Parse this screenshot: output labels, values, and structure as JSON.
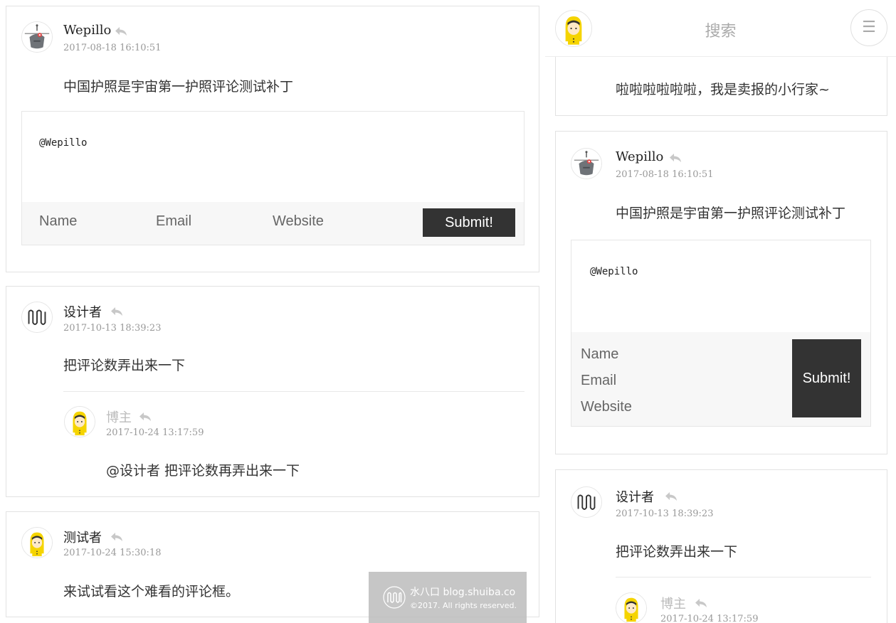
{
  "header": {
    "title": "搜索",
    "menu_glyph": "☰"
  },
  "left": {
    "c1": {
      "name": "Wepillo",
      "date": "2017-08-18 16:10:51",
      "text": "中国护照是宇宙第一护照评论测试补丁",
      "editor": {
        "value": "@Wepillo",
        "name_placeholder": "Name",
        "email_placeholder": "Email",
        "website_placeholder": "Website",
        "submit_label": "Submit!"
      }
    },
    "c2": {
      "name": "设计者",
      "date": "2017-10-13 18:39:23",
      "text": "把评论数弄出来一下",
      "reply": {
        "name": "博主",
        "date": "2017-10-24 13:17:59",
        "text": "@设计者 把评论数再弄出来一下"
      }
    },
    "c3": {
      "name": "测试者",
      "date": "2017-10-24 15:30:18",
      "text": "来试试看这个难看的评论框。"
    }
  },
  "right": {
    "c0": {
      "text": "啦啦啦啦啦啦，我是卖报的小行家~"
    },
    "c1": {
      "name": "Wepillo",
      "date": "2017-08-18 16:10:51",
      "text": "中国护照是宇宙第一护照评论测试补丁",
      "editor": {
        "value": "@Wepillo",
        "name_placeholder": "Name",
        "email_placeholder": "Email",
        "website_placeholder": "Website",
        "submit_label": "Submit!"
      }
    },
    "c2": {
      "name": "设计者",
      "date": "2017-10-13 18:39:23",
      "text": "把评论数弄出来一下",
      "reply": {
        "name": "博主",
        "date": "2017-10-24 13:17:59"
      }
    }
  },
  "watermark": {
    "line1": "水八口 blog.shuiba.co",
    "line2": "©2017. All rights reserved."
  },
  "colors": {
    "submit_bg": "#333333",
    "avatar_yellow": "#f5d400",
    "muted_text": "#bbbbbb"
  },
  "icons": [
    "robot-avatar-icon",
    "squiggle-avatar-icon",
    "girl-avatar-icon",
    "reply-icon",
    "menu-icon"
  ]
}
